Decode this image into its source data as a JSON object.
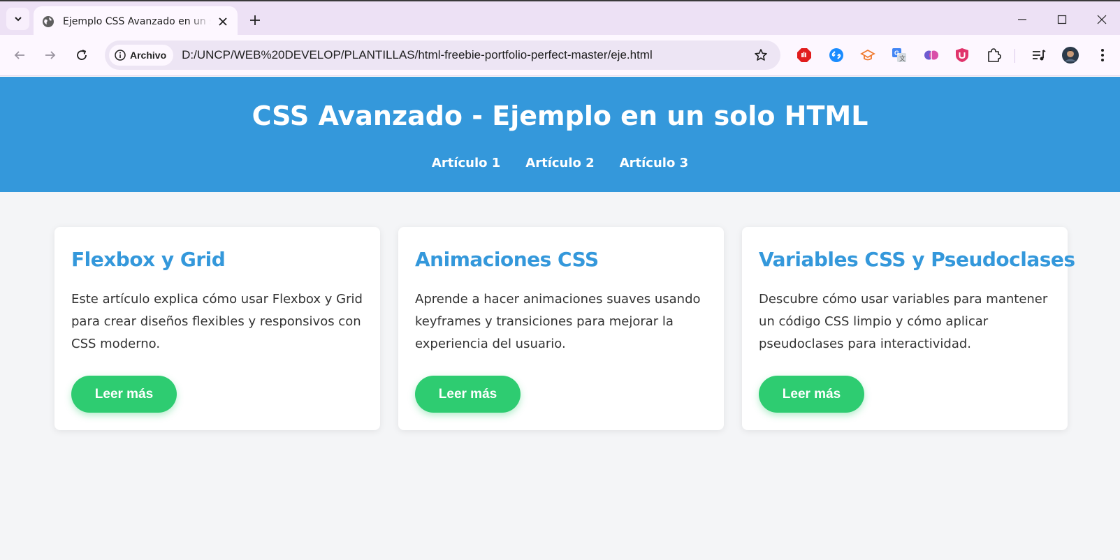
{
  "browser": {
    "tab_title": "Ejemplo CSS Avanzado en un solo HTML",
    "chip_label": "Archivo",
    "url": "D:/UNCP/WEB%20DEVELOP/PLANTILLAS/html-freebie-portfolio-perfect-master/eje.html",
    "extensions": [
      "adblock-icon",
      "shazam-icon",
      "scholar-icon",
      "translate-icon",
      "brain-icon",
      "ublock-icon",
      "puzzle-extensions-icon"
    ]
  },
  "header": {
    "title": "CSS Avanzado - Ejemplo en un solo HTML",
    "nav": [
      "Artículo 1",
      "Artículo 2",
      "Artículo 3"
    ]
  },
  "cards": [
    {
      "title": "Flexbox y Grid",
      "text": "Este artículo explica cómo usar Flexbox y Grid para crear diseños flexibles y responsivos con CSS moderno.",
      "button": "Leer más"
    },
    {
      "title": "Animaciones CSS",
      "text": "Aprende a hacer animaciones suaves usando keyframes y transiciones para mejorar la experiencia del usuario.",
      "button": "Leer más"
    },
    {
      "title": "Variables CSS y Pseudoclases",
      "text": "Descubre cómo usar variables para mantener un código CSS limpio y cómo aplicar pseudoclases para interactividad.",
      "button": "Leer más"
    }
  ],
  "colors": {
    "header_bg": "#3498db",
    "accent": "#3498db",
    "button": "#2ecc71",
    "page_bg": "#f4f5f7"
  }
}
